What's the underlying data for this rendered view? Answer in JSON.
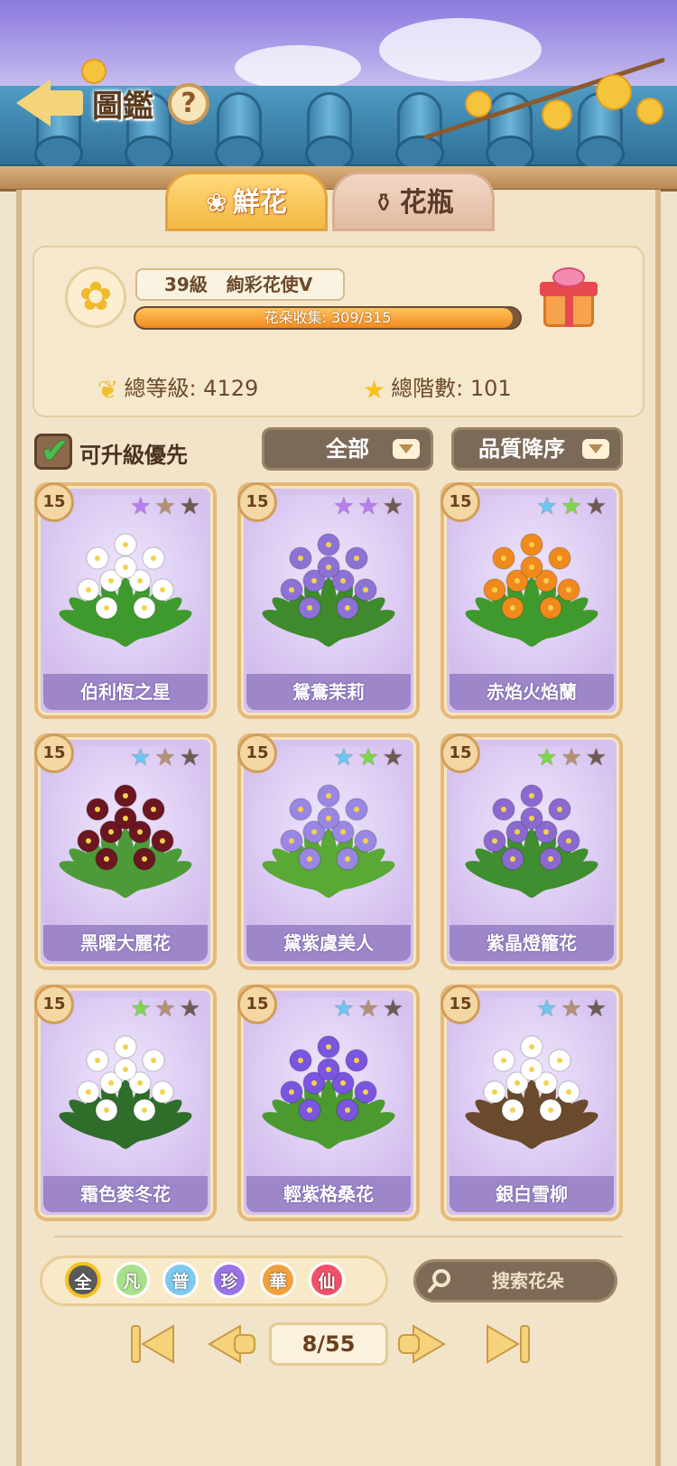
{
  "header": {
    "title": "圖鑑",
    "help_label": "?"
  },
  "tabs": [
    {
      "label": "鮮花",
      "icon": "rose-icon",
      "active": true
    },
    {
      "label": "花瓶",
      "icon": "vase-icon",
      "active": false
    }
  ],
  "player": {
    "level_text": "39級",
    "rank_title": "絢彩花使V",
    "collection_text": "花朵收集: 309/315",
    "collection_fraction": 0.981,
    "total_level_text": "總等級: 4129",
    "total_stage_text": "總階數: 101"
  },
  "filters": {
    "upgrade_priority_label": "可升級優先",
    "upgrade_priority_checked": true,
    "category_selected": "全部",
    "sort_selected": "品質降序"
  },
  "cards": [
    {
      "level": "15",
      "name": "伯利恆之星",
      "stars": [
        "purple",
        "gold",
        "dark"
      ],
      "bloom": "#ffffff",
      "leaf": "#3f9a2e"
    },
    {
      "level": "15",
      "name": "鴛鴦茉莉",
      "stars": [
        "purple",
        "purple",
        "dark"
      ],
      "bloom": "#8d72d6",
      "leaf": "#3e8a2c"
    },
    {
      "level": "15",
      "name": "赤焰火焰蘭",
      "stars": [
        "blue",
        "green",
        "dark"
      ],
      "bloom": "#f08a1d",
      "leaf": "#3f9a2e"
    },
    {
      "level": "15",
      "name": "黑曜大麗花",
      "stars": [
        "blue",
        "gold",
        "dark"
      ],
      "bloom": "#6b1620",
      "leaf": "#4c9b38"
    },
    {
      "level": "15",
      "name": "黛紫虞美人",
      "stars": [
        "blue",
        "green",
        "dark"
      ],
      "bloom": "#9a87e3",
      "leaf": "#5aa836"
    },
    {
      "level": "15",
      "name": "紫晶燈籠花",
      "stars": [
        "green",
        "gold",
        "dark"
      ],
      "bloom": "#8b6ad0",
      "leaf": "#3f8e2f"
    },
    {
      "level": "15",
      "name": "霜色麥冬花",
      "stars": [
        "green",
        "gold",
        "dark"
      ],
      "bloom": "#ffffff",
      "leaf": "#2f6e2a"
    },
    {
      "level": "15",
      "name": "輕紫格桑花",
      "stars": [
        "blue",
        "gold",
        "dark"
      ],
      "bloom": "#7a55e0",
      "leaf": "#4a9a30"
    },
    {
      "level": "15",
      "name": "銀白雪柳",
      "stars": [
        "blue",
        "gold",
        "dark"
      ],
      "bloom": "#ffffff",
      "leaf": "#6a4a2c"
    }
  ],
  "rarity_filters": [
    {
      "label": "全",
      "color": "#5b5b5b"
    },
    {
      "label": "凡",
      "color": "#a9e08a"
    },
    {
      "label": "普",
      "color": "#7dc9f0"
    },
    {
      "label": "珍",
      "color": "#9a72e8"
    },
    {
      "label": "華",
      "color": "#f2a03c"
    },
    {
      "label": "仙",
      "color": "#f0506a"
    }
  ],
  "search": {
    "placeholder": "搜索花朵"
  },
  "pager": {
    "page_text": "8/55"
  },
  "colors": {
    "accent_gold": "#f5d37a",
    "card_purple": "#d5c2ee",
    "progress_orange": "#f08a1f"
  }
}
